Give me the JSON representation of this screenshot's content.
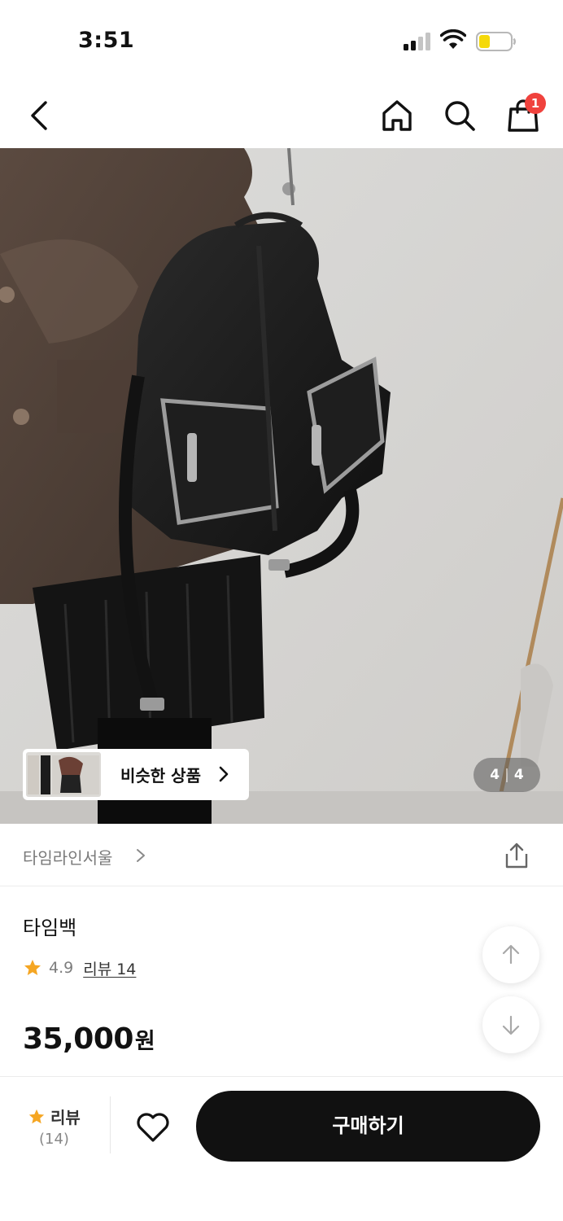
{
  "status_bar": {
    "time": "3:51"
  },
  "nav": {
    "icons": [
      "back-icon",
      "home-icon",
      "search-icon",
      "shopping-bag-icon"
    ],
    "cart_count": "1"
  },
  "hero": {
    "similar_label": "비슷한 상품",
    "page_current": "4",
    "page_separator": "|",
    "page_total": "4"
  },
  "seller": {
    "name": "타임라인서울"
  },
  "product": {
    "name": "타임백",
    "rating": "4.9",
    "review_link": "리뷰 14",
    "price": "35,000",
    "price_unit": "원"
  },
  "bottom_bar": {
    "review_label": "리뷰",
    "review_count": "(14)",
    "buy_label": "구매하기"
  },
  "colors": {
    "badge": "#f0423d",
    "star": "#f5a623",
    "buy_button": "#111111",
    "battery_fill": "#f5d90a"
  }
}
